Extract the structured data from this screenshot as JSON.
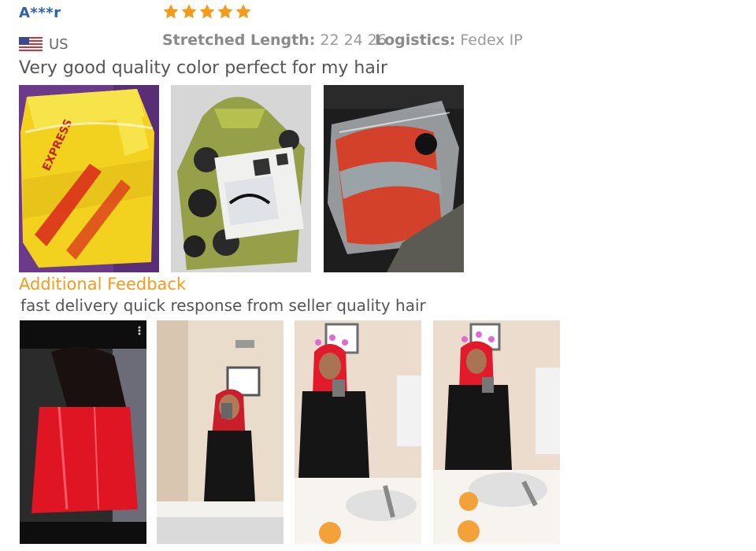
{
  "review": {
    "reviewer": "A***r",
    "country": "US",
    "rating": 5,
    "stretched_length_label": "Stretched Length:",
    "stretched_length_value": "22 24 26",
    "logistics_label": "Logistics:",
    "logistics_value": "Fedex IP",
    "text": "Very good quality color perfect for my hair",
    "additional_title": "Additional Feedback",
    "additional_text": "fast delivery quick response from seller quality hair"
  },
  "colors": {
    "star": "#f39b1c",
    "reviewer": "#2e5fb6",
    "accent": "#f39b1c"
  },
  "photos": {
    "package_photos": [
      "dhl-package-photo",
      "mesh-bag-photo",
      "hair-bundle-photo"
    ],
    "feedback_photos": [
      "hair-closeup-photo",
      "mirror-selfie-photo",
      "mirror-selfie-photo",
      "mirror-selfie-photo"
    ]
  }
}
